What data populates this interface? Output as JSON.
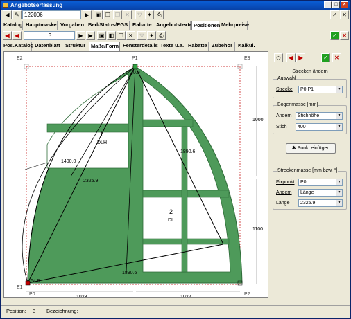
{
  "window": {
    "title": "Angebotserfassung"
  },
  "nav": {
    "record_number": "122006",
    "position_number": "3"
  },
  "main_tabs": [
    "Katalog",
    "Hauptmaske",
    "Vorgaben",
    "Bed/Status/EGS",
    "Rabatte",
    "Angebotstexte",
    "Positionen",
    "Mehrpreise"
  ],
  "sub_tabs": [
    "Pos.Katalog",
    "Datenblatt",
    "Struktur",
    "Maße/Form",
    "Fensterdetails",
    "Texte u.a.",
    "Rabatte",
    "Zubehör",
    "Kalkul."
  ],
  "drawing": {
    "corners": [
      "E2",
      "P1",
      "E3",
      "E1",
      "P0",
      "P2"
    ],
    "dims": {
      "height_upper": "1000",
      "height_lower": "1100",
      "width_left": "1023",
      "width_right": "1022"
    },
    "labels": [
      "30.9",
      "1400.0",
      "2325.9",
      "1890.6",
      "1890.6",
      "64.5"
    ],
    "panels": [
      {
        "num": "1",
        "code": "DLH"
      },
      {
        "num": "2",
        "code": "DL"
      }
    ]
  },
  "panel": {
    "title": "Strecken ändern",
    "auswahl": {
      "group": "Auswahl",
      "label": "Strecke",
      "value": "P0:P1"
    },
    "bogen": {
      "group": "Bogenmasse [mm]",
      "aendern_label": "Ändern",
      "aendern_value": "Stichhöhe",
      "stich_label": "Stich",
      "stich_value": "400"
    },
    "insert_button": "Punkt einfügen",
    "strecken": {
      "group": "Streckenmasse [mm bzw. °]",
      "fixpunkt_label": "Fixpunkt",
      "fixpunkt_value": "P0",
      "aendern_label": "Ändern",
      "aendern_value": "Länge",
      "laenge_label": "Länge",
      "laenge_value": "2325.9"
    }
  },
  "status": {
    "position_label": "Position:",
    "position_value": "3",
    "bez_label": "Bezeichnung:"
  },
  "colors": {
    "frame": "#4e9a5a",
    "frame_dark": "#2e6b38",
    "handle": "#30a040",
    "line_red": "#c00000"
  }
}
